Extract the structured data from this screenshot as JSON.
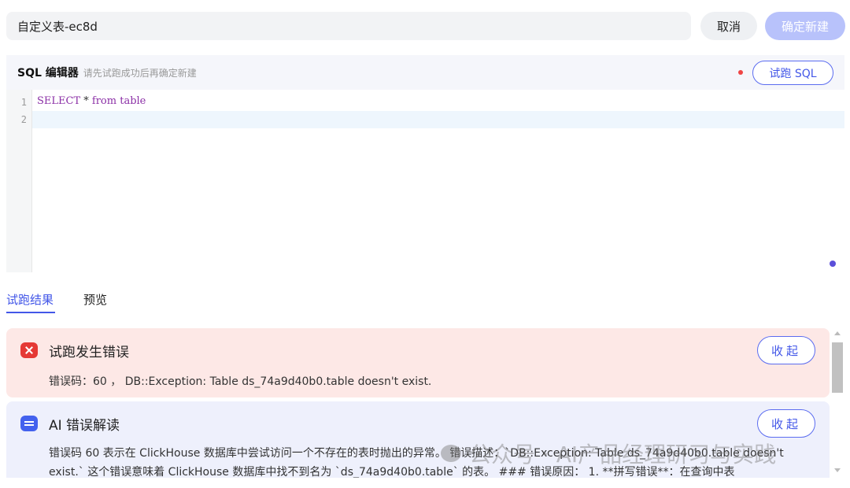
{
  "topbar": {
    "table_name": "自定义表-ec8d",
    "cancel_label": "取消",
    "confirm_label": "确定新建"
  },
  "editor": {
    "title": "SQL 编辑器",
    "hint": "请先试跑成功后再确定新建",
    "run_label": "试跑 SQL",
    "line_numbers": [
      "1",
      "2"
    ],
    "code": {
      "keyword": "SELECT",
      "star": " * ",
      "from": "from",
      "table": " table"
    }
  },
  "tabs": [
    {
      "label": "试跑结果"
    },
    {
      "label": "预览"
    }
  ],
  "error_panel": {
    "title": "试跑发生错误",
    "collapse_label": "收起",
    "message": "错误码：60 ， DB::Exception: Table ds_74a9d40b0.table doesn't exist."
  },
  "ai_panel": {
    "title": "AI 错误解读",
    "collapse_label": "收起",
    "message": "错误码 60 表示在 ClickHouse 数据库中尝试访问一个不存在的表时抛出的异常。 错误描述：`DB::Exception: Table ds_74a9d40b0.table doesn't exist.` 这个错误意味着 ClickHouse 数据库中找不到名为 `ds_74a9d40b0.table` 的表。 ### 错误原因： 1. **拼写错误**：在查询中表"
  },
  "watermark": {
    "text": "公众号 · AI产品经理研习与实践"
  },
  "colors": {
    "accent": "#4357e8",
    "error_bg": "#fde8e6",
    "ai_bg": "#eef0fc",
    "confirm_disabled": "#b8c2fb"
  }
}
